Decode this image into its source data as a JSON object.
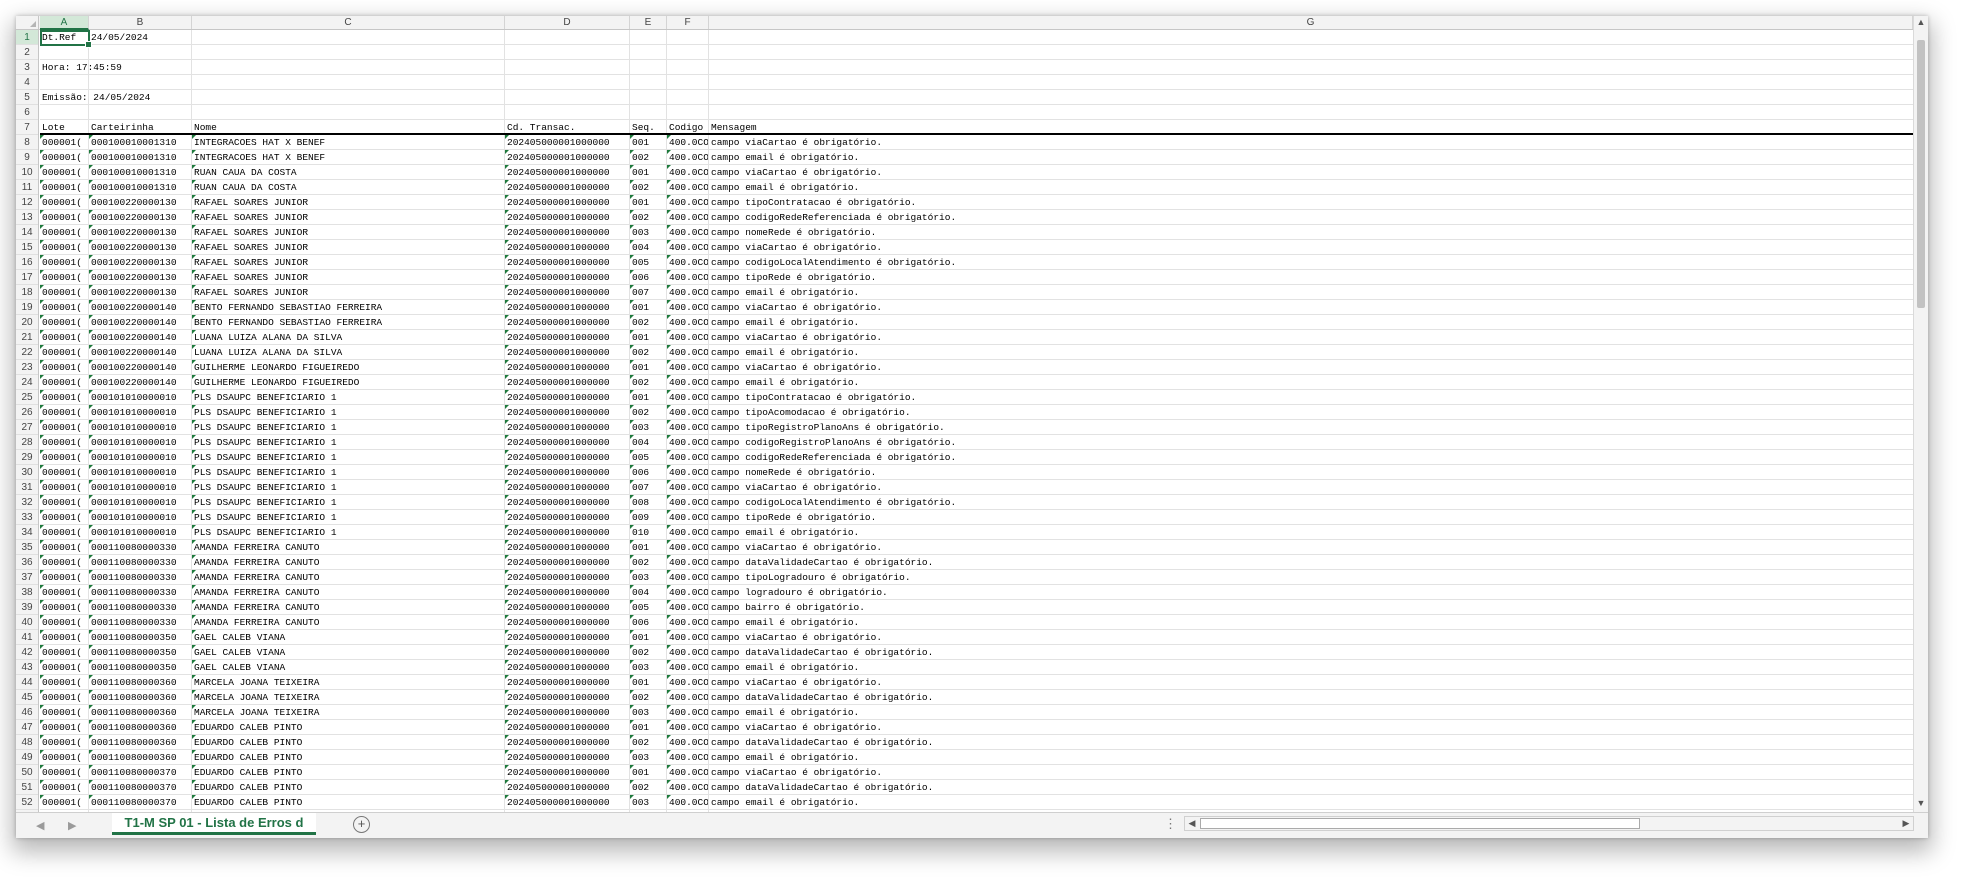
{
  "columns": [
    "A",
    "B",
    "C",
    "D",
    "E",
    "F",
    "G"
  ],
  "header_block": [
    {
      "row": 1,
      "a": "Dt.Ref",
      "b": "24/05/2024"
    },
    {
      "row": 2,
      "a": ""
    },
    {
      "row": 3,
      "a": "Hora: 17:45:59"
    },
    {
      "row": 4,
      "a": ""
    },
    {
      "row": 5,
      "a": "Emissão: 24/05/2024"
    },
    {
      "row": 6,
      "a": ""
    }
  ],
  "table_headers": [
    "Lote",
    "Carteirinha",
    "Nome",
    "Cd. Transac.",
    "Seq.",
    "Codigo",
    "Mensagem"
  ],
  "rows": [
    [
      "000001(",
      "000100010001310",
      "INTEGRACOES HAT X BENEF",
      "202405000001000000",
      "001",
      "400.0CO",
      "campo viaCartao é obrigatório."
    ],
    [
      "000001(",
      "000100010001310",
      "INTEGRACOES HAT X BENEF",
      "202405000001000000",
      "002",
      "400.0CO",
      "campo email é obrigatório."
    ],
    [
      "000001(",
      "000100010001310",
      "RUAN CAUA DA COSTA",
      "202405000001000000",
      "001",
      "400.0CO",
      "campo viaCartao é obrigatório."
    ],
    [
      "000001(",
      "000100010001310",
      "RUAN CAUA DA COSTA",
      "202405000001000000",
      "002",
      "400.0CO",
      "campo email é obrigatório."
    ],
    [
      "000001(",
      "000100220000130",
      "RAFAEL SOARES JUNIOR",
      "202405000001000000",
      "001",
      "400.0CO",
      "campo tipoContratacao é obrigatório."
    ],
    [
      "000001(",
      "000100220000130",
      "RAFAEL SOARES JUNIOR",
      "202405000001000000",
      "002",
      "400.0CO",
      "campo codigoRedeReferenciada é obrigatório."
    ],
    [
      "000001(",
      "000100220000130",
      "RAFAEL SOARES JUNIOR",
      "202405000001000000",
      "003",
      "400.0CO",
      "campo nomeRede é obrigatório."
    ],
    [
      "000001(",
      "000100220000130",
      "RAFAEL SOARES JUNIOR",
      "202405000001000000",
      "004",
      "400.0CO",
      "campo viaCartao é obrigatório."
    ],
    [
      "000001(",
      "000100220000130",
      "RAFAEL SOARES JUNIOR",
      "202405000001000000",
      "005",
      "400.0CO",
      "campo codigoLocalAtendimento é obrigatório."
    ],
    [
      "000001(",
      "000100220000130",
      "RAFAEL SOARES JUNIOR",
      "202405000001000000",
      "006",
      "400.0CO",
      "campo tipoRede é obrigatório."
    ],
    [
      "000001(",
      "000100220000130",
      "RAFAEL SOARES JUNIOR",
      "202405000001000000",
      "007",
      "400.0CO",
      "campo email é obrigatório."
    ],
    [
      "000001(",
      "000100220000140",
      "BENTO FERNANDO SEBASTIAO FERREIRA",
      "202405000001000000",
      "001",
      "400.0CO",
      "campo viaCartao é obrigatório."
    ],
    [
      "000001(",
      "000100220000140",
      "BENTO FERNANDO SEBASTIAO FERREIRA",
      "202405000001000000",
      "002",
      "400.0CO",
      "campo email é obrigatório."
    ],
    [
      "000001(",
      "000100220000140",
      "LUANA LUIZA ALANA DA SILVA",
      "202405000001000000",
      "001",
      "400.0CO",
      "campo viaCartao é obrigatório."
    ],
    [
      "000001(",
      "000100220000140",
      "LUANA LUIZA ALANA DA SILVA",
      "202405000001000000",
      "002",
      "400.0CO",
      "campo email é obrigatório."
    ],
    [
      "000001(",
      "000100220000140",
      "GUILHERME LEONARDO FIGUEIREDO",
      "202405000001000000",
      "001",
      "400.0CO",
      "campo viaCartao é obrigatório."
    ],
    [
      "000001(",
      "000100220000140",
      "GUILHERME LEONARDO FIGUEIREDO",
      "202405000001000000",
      "002",
      "400.0CO",
      "campo email é obrigatório."
    ],
    [
      "000001(",
      "000101010000010",
      "PLS DSAUPC BENEFICIARIO 1",
      "202405000001000000",
      "001",
      "400.0CO",
      "campo tipoContratacao é obrigatório."
    ],
    [
      "000001(",
      "000101010000010",
      "PLS DSAUPC BENEFICIARIO 1",
      "202405000001000000",
      "002",
      "400.0CO",
      "campo tipoAcomodacao é obrigatório."
    ],
    [
      "000001(",
      "000101010000010",
      "PLS DSAUPC BENEFICIARIO 1",
      "202405000001000000",
      "003",
      "400.0CO",
      "campo tipoRegistroPlanoAns é obrigatório."
    ],
    [
      "000001(",
      "000101010000010",
      "PLS DSAUPC BENEFICIARIO 1",
      "202405000001000000",
      "004",
      "400.0CO",
      "campo codigoRegistroPlanoAns é obrigatório."
    ],
    [
      "000001(",
      "000101010000010",
      "PLS DSAUPC BENEFICIARIO 1",
      "202405000001000000",
      "005",
      "400.0CO",
      "campo codigoRedeReferenciada é obrigatório."
    ],
    [
      "000001(",
      "000101010000010",
      "PLS DSAUPC BENEFICIARIO 1",
      "202405000001000000",
      "006",
      "400.0CO",
      "campo nomeRede é obrigatório."
    ],
    [
      "000001(",
      "000101010000010",
      "PLS DSAUPC BENEFICIARIO 1",
      "202405000001000000",
      "007",
      "400.0CO",
      "campo viaCartao é obrigatório."
    ],
    [
      "000001(",
      "000101010000010",
      "PLS DSAUPC BENEFICIARIO 1",
      "202405000001000000",
      "008",
      "400.0CO",
      "campo codigoLocalAtendimento é obrigatório."
    ],
    [
      "000001(",
      "000101010000010",
      "PLS DSAUPC BENEFICIARIO 1",
      "202405000001000000",
      "009",
      "400.0CO",
      "campo tipoRede é obrigatório."
    ],
    [
      "000001(",
      "000101010000010",
      "PLS DSAUPC BENEFICIARIO 1",
      "202405000001000000",
      "010",
      "400.0CO",
      "campo email é obrigatório."
    ],
    [
      "000001(",
      "000110080000330",
      "AMANDA FERREIRA CANUTO",
      "202405000001000000",
      "001",
      "400.0CO",
      "campo viaCartao é obrigatório."
    ],
    [
      "000001(",
      "000110080000330",
      "AMANDA FERREIRA CANUTO",
      "202405000001000000",
      "002",
      "400.0CO",
      "campo dataValidadeCartao é obrigatório."
    ],
    [
      "000001(",
      "000110080000330",
      "AMANDA FERREIRA CANUTO",
      "202405000001000000",
      "003",
      "400.0CO",
      "campo tipoLogradouro é obrigatório."
    ],
    [
      "000001(",
      "000110080000330",
      "AMANDA FERREIRA CANUTO",
      "202405000001000000",
      "004",
      "400.0CO",
      "campo logradouro é obrigatório."
    ],
    [
      "000001(",
      "000110080000330",
      "AMANDA FERREIRA CANUTO",
      "202405000001000000",
      "005",
      "400.0CO",
      "campo bairro é obrigatório."
    ],
    [
      "000001(",
      "000110080000330",
      "AMANDA FERREIRA CANUTO",
      "202405000001000000",
      "006",
      "400.0CO",
      "campo email é obrigatório."
    ],
    [
      "000001(",
      "000110080000350",
      "GAEL CALEB VIANA",
      "202405000001000000",
      "001",
      "400.0CO",
      "campo viaCartao é obrigatório."
    ],
    [
      "000001(",
      "000110080000350",
      "GAEL CALEB VIANA",
      "202405000001000000",
      "002",
      "400.0CO",
      "campo dataValidadeCartao é obrigatório."
    ],
    [
      "000001(",
      "000110080000350",
      "GAEL CALEB VIANA",
      "202405000001000000",
      "003",
      "400.0CO",
      "campo email é obrigatório."
    ],
    [
      "000001(",
      "000110080000360",
      "MARCELA JOANA TEIXEIRA",
      "202405000001000000",
      "001",
      "400.0CO",
      "campo viaCartao é obrigatório."
    ],
    [
      "000001(",
      "000110080000360",
      "MARCELA JOANA TEIXEIRA",
      "202405000001000000",
      "002",
      "400.0CO",
      "campo dataValidadeCartao é obrigatório."
    ],
    [
      "000001(",
      "000110080000360",
      "MARCELA JOANA TEIXEIRA",
      "202405000001000000",
      "003",
      "400.0CO",
      "campo email é obrigatório."
    ],
    [
      "000001(",
      "000110080000360",
      "EDUARDO CALEB PINTO",
      "202405000001000000",
      "001",
      "400.0CO",
      "campo viaCartao é obrigatório."
    ],
    [
      "000001(",
      "000110080000360",
      "EDUARDO CALEB PINTO",
      "202405000001000000",
      "002",
      "400.0CO",
      "campo dataValidadeCartao é obrigatório."
    ],
    [
      "000001(",
      "000110080000360",
      "EDUARDO CALEB PINTO",
      "202405000001000000",
      "003",
      "400.0CO",
      "campo email é obrigatório."
    ],
    [
      "000001(",
      "000110080000370",
      "EDUARDO CALEB PINTO",
      "202405000001000000",
      "001",
      "400.0CO",
      "campo viaCartao é obrigatório."
    ],
    [
      "000001(",
      "000110080000370",
      "EDUARDO CALEB PINTO",
      "202405000001000000",
      "002",
      "400.0CO",
      "campo dataValidadeCartao é obrigatório."
    ],
    [
      "000001(",
      "000110080000370",
      "EDUARDO CALEB PINTO",
      "202405000001000000",
      "003",
      "400.0CO",
      "campo email é obrigatório."
    ]
  ],
  "sheet_tab": {
    "label": "T1-M SP 01  - Lista de Erros d"
  },
  "icons": {
    "add_sheet": "plus-circle-icon",
    "prev": "chevron-left-icon",
    "next": "chevron-right-icon",
    "more": "vertical-dots-icon"
  },
  "colors": {
    "accent": "#217346",
    "indicator": "#1e7a3c"
  }
}
